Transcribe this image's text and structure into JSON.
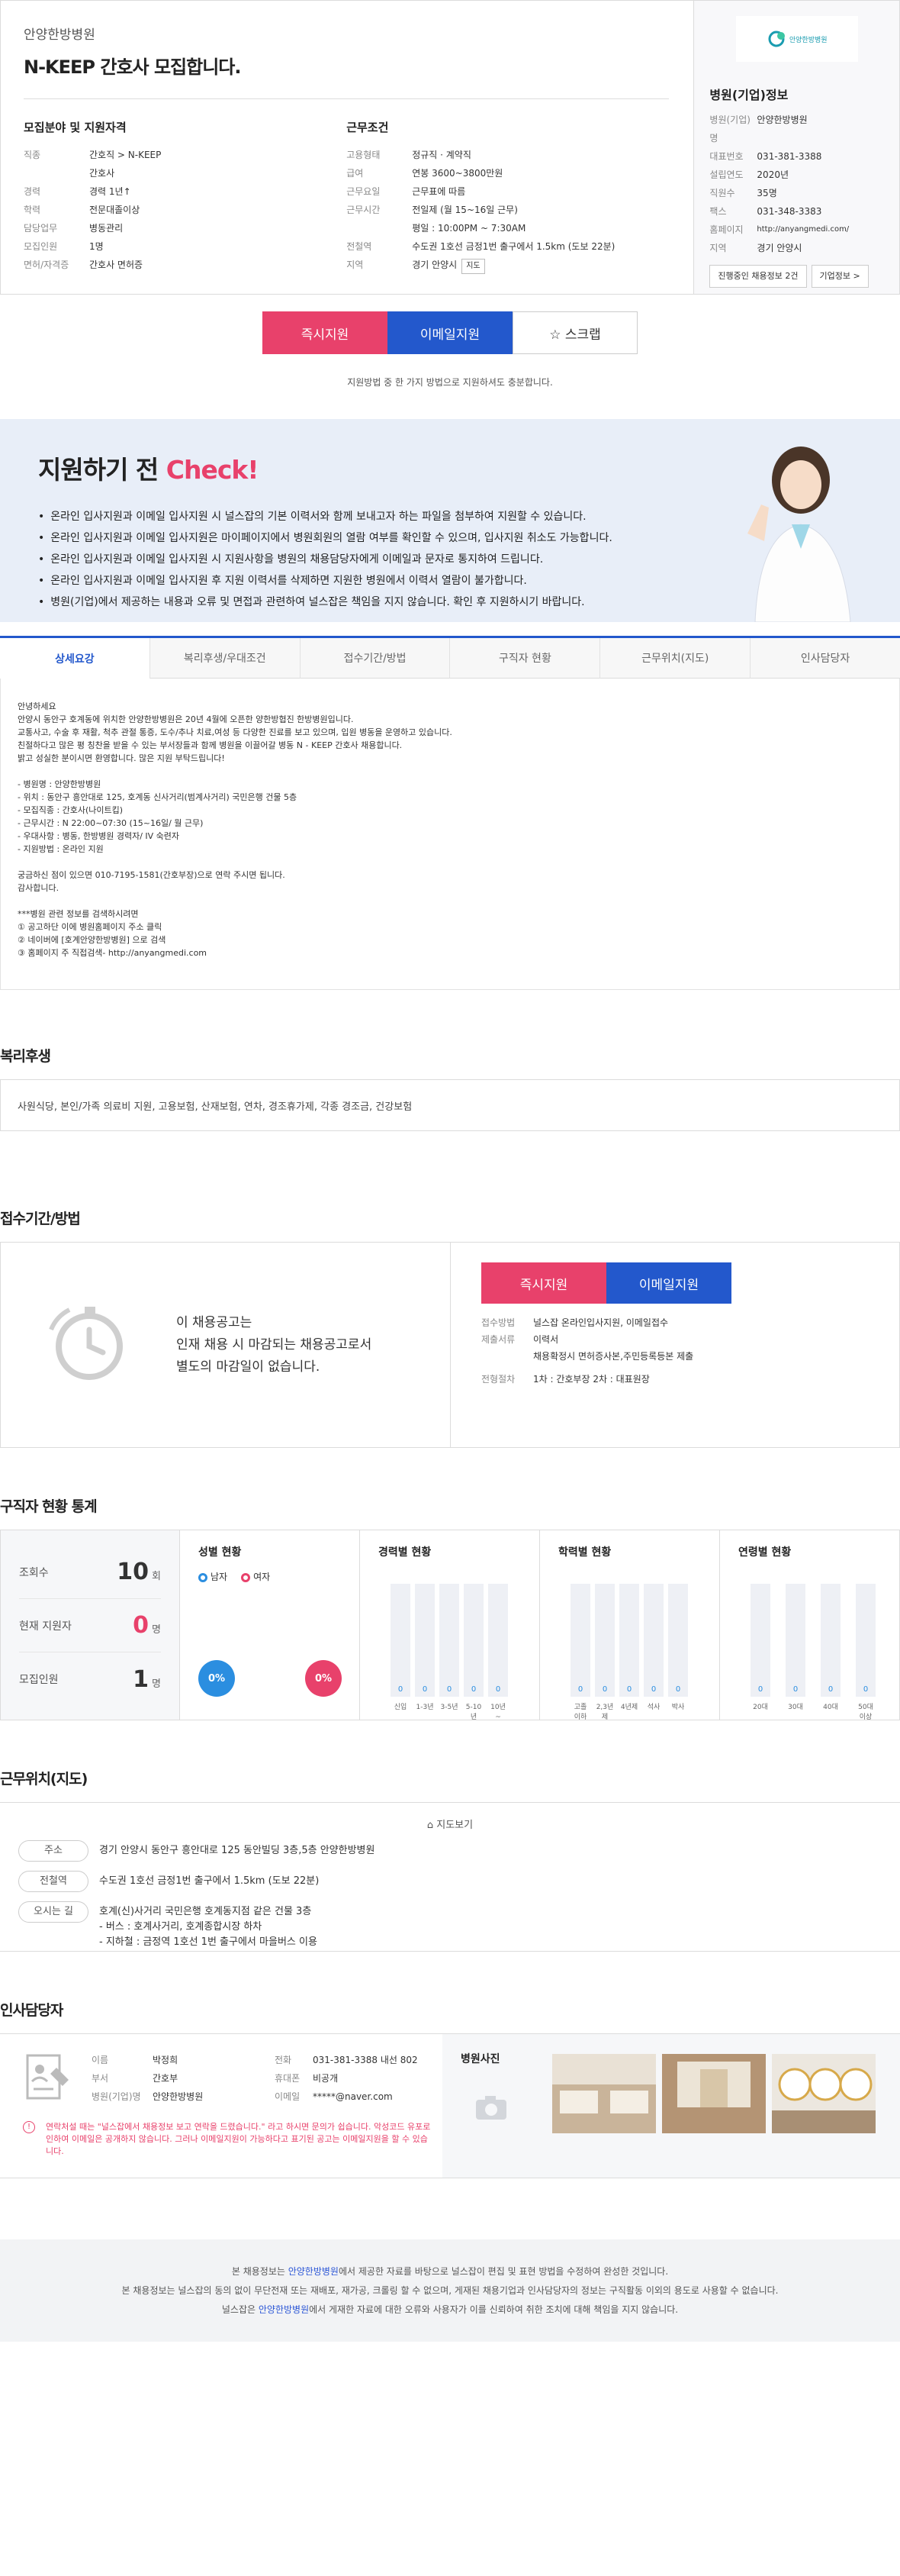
{
  "header": {
    "hospital": "안양한방병원",
    "title": "N-KEEP 간호사 모집합니다.",
    "left_heading": "모집분야 및 지원자격",
    "left_rows": [
      {
        "k": "직종",
        "v": "간호직 > N-KEEP"
      },
      {
        "k": "",
        "v": "간호사"
      },
      {
        "k": "경력",
        "v": "경력 1년↑"
      },
      {
        "k": "학력",
        "v": "전문대졸이상"
      },
      {
        "k": "담당업무",
        "v": "병동관리"
      },
      {
        "k": "모집인원",
        "v": "1명"
      },
      {
        "k": "면허/자격증",
        "v": "간호사 면허증"
      }
    ],
    "right_heading": "근무조건",
    "right_rows": [
      {
        "k": "고용형태",
        "v": "정규직 · 계약직"
      },
      {
        "k": "급여",
        "v": "연봉 3600~3800만원"
      },
      {
        "k": "근무요일",
        "v": "근무표에 따름"
      },
      {
        "k": "근무시간",
        "v": "전일제 (월 15~16일 근무)"
      },
      {
        "k": "",
        "v": "평일 : 10:00PM ~ 7:30AM"
      },
      {
        "k": "전철역",
        "v": "수도권 1호선 금정1번 출구에서 1.5km (도보 22분)"
      },
      {
        "k": "지역",
        "v": "경기 안양시"
      }
    ],
    "map_btn": "지도"
  },
  "side": {
    "logo_text": "안양한방병원",
    "heading": "병원(기업)정보",
    "rows": [
      {
        "k": "병원(기업)명",
        "v": "안양한방병원"
      },
      {
        "k": "대표번호",
        "v": "031-381-3388"
      },
      {
        "k": "설립연도",
        "v": "2020년"
      },
      {
        "k": "직원수",
        "v": "35명"
      },
      {
        "k": "팩스",
        "v": "031-348-3383"
      },
      {
        "k": "홈페이지",
        "v": "http://anyangmedi.com/"
      },
      {
        "k": "지역",
        "v": "경기 안양시"
      }
    ],
    "btn_recruit": "진행중인 채용정보 2건",
    "btn_info": "기업정보 >"
  },
  "apply": {
    "now": "즉시지원",
    "mail": "이메일지원",
    "scrap": "☆ 스크랩",
    "note": "지원방법 중 한 가지 방법으로 지원하셔도 충분합니다."
  },
  "check": {
    "title_a": "지원하기 전 ",
    "title_b": "Check!",
    "items": [
      "온라인 입사지원과 이메일 입사지원 시 널스잡의 기본 이력서와 함께 보내고자 하는 파일을 첨부하여 지원할 수 있습니다.",
      "온라인 입사지원과 이메일 입사지원은 마이페이지에서 병원회원의 열람 여부를 확인할 수 있으며, 입사지원 취소도 가능합니다.",
      "온라인 입사지원과 이메일 입사지원 시 지원사항을 병원의 채용담당자에게 이메일과 문자로 통지하여 드립니다.",
      "온라인 입사지원과 이메일 입사지원 후 지원 이력서를 삭제하면 지원한 병원에서 이력서 열람이 불가합니다.",
      "병원(기업)에서 제공하는 내용과 오류 및 면접과 관련하여 널스잡은 책임을 지지 않습니다. 확인 후 지원하시기 바랍니다."
    ]
  },
  "tabs": [
    "상세요강",
    "복리후생/우대조건",
    "접수기간/방법",
    "구직자 현황",
    "근무위치(지도)",
    "인사담당자"
  ],
  "detail": "안녕하세요\n안양시 동안구 호계동에 위치한 안양한방병원은 20년 4월에 오픈한 양한방협진 한방병원입니다.\n교통사고, 수술 후 재활, 척추 관절 통증, 도수/추나 치료,여성 등 다양한 진료를 보고 있으며, 입원 병동을 운영하고 있습니다.\n친절하다고 많은 평 칭찬을 받을 수 있는 부서장들과 함께 병원을 이끌어갈 병동 N - KEEP 간호사 채용합니다.\n밝고 성실한 분이시면 환영합니다. 많은 지원 부탁드립니다!\n\n- 병원명 : 안양한방병원\n- 위치 : 동안구 흥안대로 125, 호계동 신사거리(범계사거리) 국민은행 건물 5층\n- 모집직종 : 간호사(나이트킵)\n- 근무시간 : N 22:00~07:30 (15~16일/ 월 근무)\n- 우대사항 : 병동, 한방병원 경력자/ IV 숙련자\n- 지원방법 : 온라인 지원\n\n궁금하신 점이 있으면 010-7195-1581(간호부장)으로 연락 주시면 됩니다.\n감사합니다.\n\n***병원 관련 정보를 검색하시려면\n① 공고하단 이에 병원홈페이지 주소 클릭\n② 네이버에 [호계안양한방병원] 으로 검색\n③ 홈페이지 주 직접검색- http://anyangmedi.com",
  "welfare": {
    "heading": "복리후생",
    "text": "사원식당, 본인/가족 의료비 지원, 고용보험, 산재보험, 연차, 경조휴가제, 각종 경조금, 건강보험"
  },
  "recruit": {
    "heading": "접수기간/방법",
    "msg": "이 채용공고는\n인재 채용 시 마감되는 채용공고로서\n별도의 마감일이 없습니다.",
    "rows": [
      {
        "k": "접수방법",
        "v": "널스잡 온라인입사지원, 이메일접수"
      },
      {
        "k": "제출서류",
        "v": "이력서"
      },
      {
        "k": "",
        "v": "채용확정시 면허증사본,주민등록등본 제출"
      },
      {
        "k": "전형절차",
        "v": "1차 : 간호부장   2차 : 대표원장"
      }
    ]
  },
  "stats": {
    "heading": "구직자 현황 통계",
    "views_lbl": "조회수",
    "views": "10",
    "views_unit": "회",
    "applicants_lbl": "현재 지원자",
    "applicants": "0",
    "applicants_unit": "명",
    "recruit_lbl": "모집인원",
    "recruit": "1",
    "recruit_unit": "명",
    "gender_h": "성별 현황",
    "male": "남자",
    "female": "여자",
    "male_pct": "0%",
    "female_pct": "0%",
    "career_h": "경력별 현황",
    "career_lbls": [
      "신입",
      "1-3년",
      "3-5년",
      "5-10년",
      "10년~"
    ],
    "edu_h": "학력별 현황",
    "edu_lbls": [
      "고졸 이하",
      "2,3년제",
      "4년제",
      "석사",
      "박사"
    ],
    "age_h": "연령별 현황",
    "age_lbls": [
      "20대",
      "30대",
      "40대",
      "50대이상"
    ],
    "zero": "0"
  },
  "location": {
    "heading": "근무위치(지도)",
    "view": "지도보기",
    "rows": [
      {
        "k": "주소",
        "v": "경기 안양시 동안구 흥안대로 125 동안빌딩 3층,5층 안양한방병원"
      },
      {
        "k": "전철역",
        "v": "수도권 1호선 금정1번 출구에서 1.5km (도보 22분)"
      },
      {
        "k": "오시는 길",
        "v": "호계(신)사거리 국민은행 호계동지점 같은 건물 3층\n- 버스 : 호계사거리, 호계종합시장 하차\n- 지하철 : 금정역 1호선 1번 출구에서 마을버스 이용"
      }
    ]
  },
  "contact": {
    "heading": "인사담당자",
    "left": [
      {
        "k": "이름",
        "v": "박정희"
      },
      {
        "k": "부서",
        "v": "간호부"
      },
      {
        "k": "병원(기업)명",
        "v": "안양한방병원"
      }
    ],
    "right": [
      {
        "k": "전화",
        "v": "031-381-3388 내선 802"
      },
      {
        "k": "휴대폰",
        "v": "비공개"
      },
      {
        "k": "이메일",
        "v": "*****@naver.com"
      }
    ],
    "warn": "연락처설 때는 \"널스잡에서 채용정보 보고 연락을 드렸습니다.\" 라고 하시면 문의가 쉽습니다. 악성코드 유포로 인하여 이메일은 공개하지 않습니다. 그러나 이메일지원이 가능하다고 표기된 공고는 이메일지원을 할 수 있습니다.",
    "photo_h": "병원사진"
  },
  "footer": {
    "l1a": "본 채용정보는 ",
    "l1b": "안양한방병원",
    "l1c": "에서 제공한 자료를 바탕으로 널스잡이 편집 및 표현 방법을 수정하여 완성한 것입니다.",
    "l2": "본 채용정보는 널스잡의 동의 없이 무단전재 또는 재배포, 재가공, 크롤링 할 수 없으며, 게재된 채용기업과 인사담당자의 정보는 구직활동 이외의 용도로 사용할 수 없습니다.",
    "l3a": "널스잡은 ",
    "l3b": "안양한방병원",
    "l3c": "에서 게재한 자료에 대한 오류와 사용자가 이를 신뢰하여 취한 조치에 대해 책임을 지지 않습니다."
  },
  "colors": {
    "accent_blue": "#2358cc",
    "accent_red": "#e8416b"
  }
}
